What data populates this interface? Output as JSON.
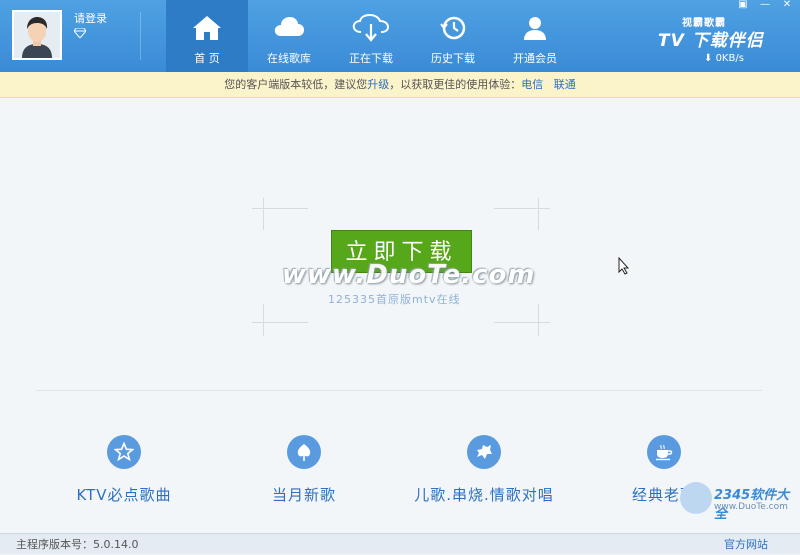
{
  "user": {
    "login_label": "请登录",
    "vip_icon": "diamond-icon"
  },
  "nav": {
    "items": [
      {
        "label": "首 页",
        "icon": "home-icon"
      },
      {
        "label": "在线歌库",
        "icon": "cloud-icon"
      },
      {
        "label": "正在下载",
        "icon": "cloud-download-icon"
      },
      {
        "label": "历史下载",
        "icon": "history-icon"
      },
      {
        "label": "开通会员",
        "icon": "member-icon"
      }
    ],
    "active_index": 0
  },
  "window": {
    "buttons": [
      "▣",
      "—",
      "✕"
    ]
  },
  "brand": {
    "small": "视霸歌霸",
    "big": "TV 下载伴侣",
    "speed": "0KB/s"
  },
  "notice": {
    "prefix": "您的客户端版本较低，建议您",
    "upgrade": "升级",
    "middle": "，以获取更佳的使用体验：",
    "link1": "电信",
    "link2": "联通"
  },
  "main": {
    "download_button": "立即下载",
    "watermark": "www.DuoTe.com",
    "subline": "125335首原版mtv在线"
  },
  "categories": [
    {
      "label": "KTV必点歌曲",
      "icon": "star-icon"
    },
    {
      "label": "当月新歌",
      "icon": "leaf-icon"
    },
    {
      "label": "儿歌.串烧.情歌对唱",
      "icon": "puzzle-icon"
    },
    {
      "label": "经典老歌",
      "icon": "cup-icon"
    }
  ],
  "footer": {
    "version": "主程序版本号：5.0.14.0",
    "site": "官方网站"
  },
  "overlay_logo": {
    "brand": "2345软件大全",
    "url": "www.DuoTe.com"
  },
  "colors": {
    "header": "#3a8bd6",
    "accent_green": "#57a71a",
    "link": "#2a6fc0",
    "category_blue": "#5a9be0"
  }
}
